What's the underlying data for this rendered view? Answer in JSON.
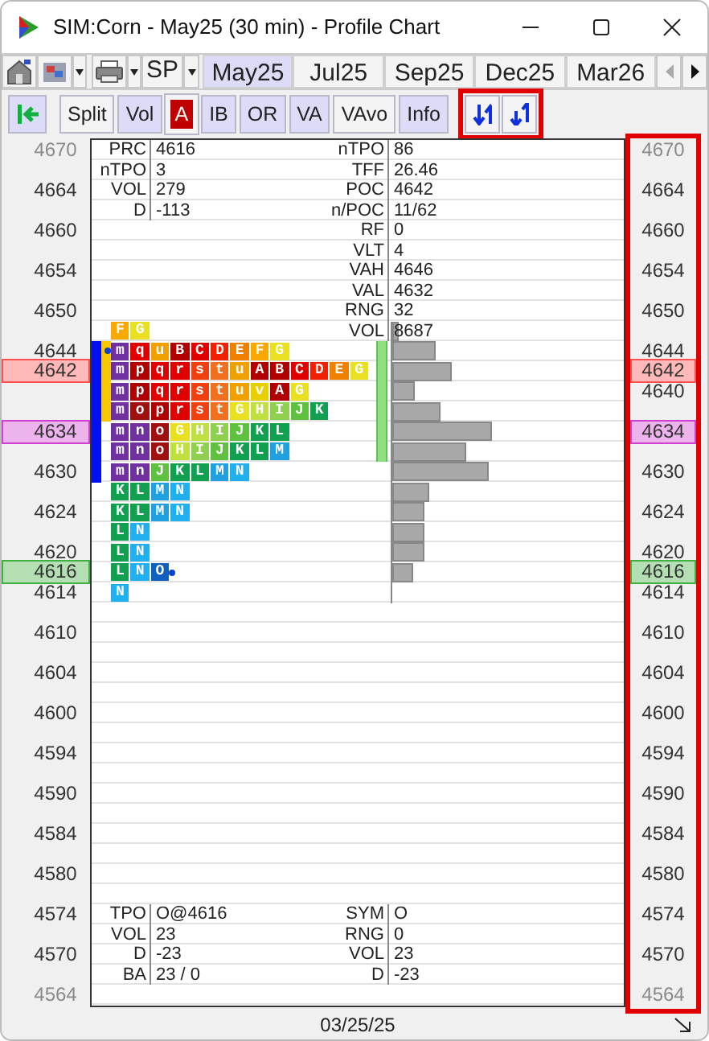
{
  "window": {
    "title": "SIM:Corn - May25 (30 min) - Profile Chart"
  },
  "tab_bar": {
    "symbol_menu": "SP",
    "tabs": [
      {
        "label": "May25",
        "selected": true
      },
      {
        "label": "Jul25",
        "selected": false
      },
      {
        "label": "Sep25",
        "selected": false
      },
      {
        "label": "Dec25",
        "selected": false
      },
      {
        "label": "Mar26",
        "selected": false
      }
    ],
    "scroll": [
      {
        "disabled": true
      },
      {
        "disabled": false
      }
    ]
  },
  "toolbar": [
    {
      "label": "Split",
      "kind": "toggle",
      "on": false
    },
    {
      "label": "Vol",
      "kind": "toggle",
      "on": true
    },
    {
      "label": "A",
      "kind": "color",
      "color": "#c00000"
    },
    {
      "label": "IB",
      "kind": "toggle",
      "on": true
    },
    {
      "label": "OR",
      "kind": "toggle",
      "on": true
    },
    {
      "label": "VA",
      "kind": "toggle",
      "on": true
    },
    {
      "label": "VAvo",
      "kind": "toggle",
      "on": false
    },
    {
      "label": "Info",
      "kind": "toggle",
      "on": true
    }
  ],
  "rows": [
    {
      "left_axis": {
        "text": "4670",
        "kind": "faded"
      },
      "right_axis": {
        "text": "4670",
        "kind": "faded"
      },
      "left_stat": {
        "label": "PRC",
        "value": "4616"
      },
      "right_stat": {
        "label": "nTPO",
        "value": "86"
      }
    },
    {
      "left_stat": {
        "label": "nTPO",
        "value": "3"
      },
      "right_stat": {
        "label": "TFF",
        "value": "26.46"
      }
    },
    {
      "left_axis": {
        "text": "4664",
        "kind": "plain"
      },
      "right_axis": {
        "text": "4664",
        "kind": "plain"
      },
      "left_stat": {
        "label": "VOL",
        "value": "279"
      },
      "right_stat": {
        "label": "POC",
        "value": "4642"
      }
    },
    {
      "left_stat": {
        "label": "D",
        "value": "-113"
      },
      "right_stat": {
        "label": "n/POC",
        "value": "11/62"
      }
    },
    {
      "left_axis": {
        "text": "4660",
        "kind": "plain"
      },
      "right_axis": {
        "text": "4660",
        "kind": "plain"
      },
      "right_stat": {
        "label": "RF",
        "value": "0"
      }
    },
    {
      "right_stat": {
        "label": "VLT",
        "value": "4"
      }
    },
    {
      "left_axis": {
        "text": "4654",
        "kind": "plain"
      },
      "right_axis": {
        "text": "4654",
        "kind": "plain"
      },
      "right_stat": {
        "label": "VAH",
        "value": "4646"
      }
    },
    {
      "right_stat": {
        "label": "VAL",
        "value": "4632"
      }
    },
    {
      "left_axis": {
        "text": "4650",
        "kind": "plain"
      },
      "right_axis": {
        "text": "4650",
        "kind": "plain"
      },
      "right_stat": {
        "label": "RNG",
        "value": "32"
      }
    },
    {
      "right_stat": {
        "label": "VOL",
        "value": "8687"
      },
      "tpos": [
        {
          "letter": "F",
          "color": "#f8a800"
        },
        {
          "letter": "G",
          "color": "#e8e020"
        }
      ],
      "volume": {
        "level": 0.03
      }
    },
    {
      "left_axis": {
        "text": "4644",
        "kind": "plain"
      },
      "right_axis": {
        "text": "4644",
        "kind": "plain"
      },
      "ib": true,
      "or": true,
      "va": true,
      "volume": {
        "level": 0.19
      },
      "tpos": [
        {
          "letter": "m",
          "color": "#7030a0",
          "dot": true
        },
        {
          "letter": "q",
          "color": "#e00000"
        },
        {
          "letter": "u",
          "color": "#f0a000"
        },
        {
          "letter": "B",
          "color": "#b00000"
        },
        {
          "letter": "C",
          "color": "#e00000"
        },
        {
          "letter": "D",
          "color": "#f02000"
        },
        {
          "letter": "E",
          "color": "#f08000"
        },
        {
          "letter": "F",
          "color": "#f8a800"
        },
        {
          "letter": "G",
          "color": "#e8e020"
        }
      ]
    },
    {
      "left_axis": {
        "text": "4642",
        "kind": "marker",
        "color": "#ff5050"
      },
      "right_axis": {
        "text": "4642",
        "kind": "marker",
        "color": "#ff5050"
      },
      "ib": true,
      "or": true,
      "va": true,
      "volume": {
        "level": 0.26
      },
      "tpos": [
        {
          "letter": "m",
          "color": "#7030a0"
        },
        {
          "letter": "p",
          "color": "#b00000"
        },
        {
          "letter": "q",
          "color": "#e00000"
        },
        {
          "letter": "r",
          "color": "#e00000"
        },
        {
          "letter": "s",
          "color": "#f04010"
        },
        {
          "letter": "t",
          "color": "#f07020"
        },
        {
          "letter": "u",
          "color": "#f0a000"
        },
        {
          "letter": "A",
          "color": "#b00000"
        },
        {
          "letter": "B",
          "color": "#b00000"
        },
        {
          "letter": "C",
          "color": "#e00000"
        },
        {
          "letter": "D",
          "color": "#f02000"
        },
        {
          "letter": "E",
          "color": "#f08000"
        },
        {
          "letter": "G",
          "color": "#e8e020"
        }
      ]
    },
    {
      "right_axis": {
        "text": "4640",
        "kind": "plain"
      },
      "ib": true,
      "or": true,
      "va": true,
      "volume": {
        "level": 0.1
      },
      "tpos": [
        {
          "letter": "m",
          "color": "#7030a0"
        },
        {
          "letter": "p",
          "color": "#b00000"
        },
        {
          "letter": "q",
          "color": "#e00000"
        },
        {
          "letter": "r",
          "color": "#e00000"
        },
        {
          "letter": "s",
          "color": "#f04010"
        },
        {
          "letter": "t",
          "color": "#f07020"
        },
        {
          "letter": "u",
          "color": "#f0a000"
        },
        {
          "letter": "v",
          "color": "#e8d000"
        },
        {
          "letter": "A",
          "color": "#b00000"
        },
        {
          "letter": "G",
          "color": "#e8e020"
        }
      ]
    },
    {
      "ib": true,
      "or": true,
      "va": true,
      "volume": {
        "level": 0.21
      },
      "tpos": [
        {
          "letter": "m",
          "color": "#7030a0"
        },
        {
          "letter": "o",
          "color": "#a01010"
        },
        {
          "letter": "p",
          "color": "#b00000"
        },
        {
          "letter": "r",
          "color": "#e00000"
        },
        {
          "letter": "s",
          "color": "#f04010"
        },
        {
          "letter": "t",
          "color": "#f07020"
        },
        {
          "letter": "G",
          "color": "#e8e020"
        },
        {
          "letter": "H",
          "color": "#c0e040"
        },
        {
          "letter": "I",
          "color": "#90d050"
        },
        {
          "letter": "J",
          "color": "#60c040"
        },
        {
          "letter": "K",
          "color": "#10a050"
        }
      ]
    },
    {
      "left_axis": {
        "text": "4634",
        "kind": "marker",
        "color": "#d040d0"
      },
      "right_axis": {
        "text": "4634",
        "kind": "marker",
        "color": "#d040d0"
      },
      "ib": true,
      "va": true,
      "volume": {
        "level": 0.43
      },
      "tpos": [
        {
          "letter": "m",
          "color": "#7030a0"
        },
        {
          "letter": "n",
          "color": "#7030a0"
        },
        {
          "letter": "o",
          "color": "#a01010"
        },
        {
          "letter": "G",
          "color": "#e8e020"
        },
        {
          "letter": "H",
          "color": "#c0e040"
        },
        {
          "letter": "I",
          "color": "#90d050"
        },
        {
          "letter": "J",
          "color": "#60c040"
        },
        {
          "letter": "K",
          "color": "#10a050"
        },
        {
          "letter": "L",
          "color": "#10a050"
        }
      ]
    },
    {
      "ib": true,
      "va": true,
      "volume": {
        "level": 0.32
      },
      "tpos": [
        {
          "letter": "m",
          "color": "#7030a0"
        },
        {
          "letter": "n",
          "color": "#7030a0"
        },
        {
          "letter": "o",
          "color": "#a01010"
        },
        {
          "letter": "H",
          "color": "#c0e040"
        },
        {
          "letter": "I",
          "color": "#90d050"
        },
        {
          "letter": "J",
          "color": "#60c040"
        },
        {
          "letter": "K",
          "color": "#10a050"
        },
        {
          "letter": "L",
          "color": "#10a050"
        },
        {
          "letter": "M",
          "color": "#20a0e0"
        }
      ]
    },
    {
      "left_axis": {
        "text": "4630",
        "kind": "plain"
      },
      "right_axis": {
        "text": "4630",
        "kind": "plain"
      },
      "ib": true,
      "volume": {
        "level": 0.42
      },
      "tpos": [
        {
          "letter": "m",
          "color": "#7030a0"
        },
        {
          "letter": "n",
          "color": "#7030a0"
        },
        {
          "letter": "J",
          "color": "#60c040"
        },
        {
          "letter": "K",
          "color": "#10a050"
        },
        {
          "letter": "L",
          "color": "#10a050"
        },
        {
          "letter": "M",
          "color": "#20a0e0"
        },
        {
          "letter": "N",
          "color": "#20b0f0"
        }
      ]
    },
    {
      "volume": {
        "level": 0.16
      },
      "tpos": [
        {
          "letter": "K",
          "color": "#10a050"
        },
        {
          "letter": "L",
          "color": "#10a050"
        },
        {
          "letter": "M",
          "color": "#20a0e0"
        },
        {
          "letter": "N",
          "color": "#20b0f0"
        }
      ]
    },
    {
      "left_axis": {
        "text": "4624",
        "kind": "plain"
      },
      "right_axis": {
        "text": "4624",
        "kind": "plain"
      },
      "volume": {
        "level": 0.14
      },
      "tpos": [
        {
          "letter": "K",
          "color": "#10a050"
        },
        {
          "letter": "L",
          "color": "#10a050"
        },
        {
          "letter": "M",
          "color": "#20a0e0"
        },
        {
          "letter": "N",
          "color": "#20b0f0"
        }
      ]
    },
    {
      "volume": {
        "level": 0.14
      },
      "tpos": [
        {
          "letter": "L",
          "color": "#10a050"
        },
        {
          "letter": "N",
          "color": "#20b0f0"
        }
      ]
    },
    {
      "left_axis": {
        "text": "4620",
        "kind": "plain"
      },
      "right_axis": {
        "text": "4620",
        "kind": "plain"
      },
      "volume": {
        "level": 0.14
      },
      "tpos": [
        {
          "letter": "L",
          "color": "#10a050"
        },
        {
          "letter": "N",
          "color": "#20b0f0"
        }
      ]
    },
    {
      "left_axis": {
        "text": "4616",
        "kind": "marker",
        "color": "#40b040"
      },
      "right_axis": {
        "text": "4616",
        "kind": "marker",
        "color": "#40b040"
      },
      "volume": {
        "level": 0.09
      },
      "tpos": [
        {
          "letter": "L",
          "color": "#10a050"
        },
        {
          "letter": "N",
          "color": "#20b0f0"
        },
        {
          "letter": "O",
          "color": "#1060c0",
          "dot": true
        }
      ]
    },
    {
      "left_axis": {
        "text": "4614",
        "kind": "plain"
      },
      "right_axis": {
        "text": "4614",
        "kind": "plain"
      },
      "volume": {
        "level": 0
      },
      "tpos": [
        {
          "letter": "N",
          "color": "#20b0f0"
        }
      ]
    },
    {},
    {
      "left_axis": {
        "text": "4610",
        "kind": "plain"
      },
      "right_axis": {
        "text": "4610",
        "kind": "plain"
      }
    },
    {},
    {
      "left_axis": {
        "text": "4604",
        "kind": "plain"
      },
      "right_axis": {
        "text": "4604",
        "kind": "plain"
      }
    },
    {},
    {
      "left_axis": {
        "text": "4600",
        "kind": "plain"
      },
      "right_axis": {
        "text": "4600",
        "kind": "plain"
      }
    },
    {},
    {
      "left_axis": {
        "text": "4594",
        "kind": "plain"
      },
      "right_axis": {
        "text": "4594",
        "kind": "plain"
      }
    },
    {},
    {
      "left_axis": {
        "text": "4590",
        "kind": "plain"
      },
      "right_axis": {
        "text": "4590",
        "kind": "plain"
      }
    },
    {},
    {
      "left_axis": {
        "text": "4584",
        "kind": "plain"
      },
      "right_axis": {
        "text": "4584",
        "kind": "plain"
      }
    },
    {},
    {
      "left_axis": {
        "text": "4580",
        "kind": "plain"
      },
      "right_axis": {
        "text": "4580",
        "kind": "plain"
      }
    },
    {},
    {
      "left_axis": {
        "text": "4574",
        "kind": "plain"
      },
      "right_axis": {
        "text": "4574",
        "kind": "plain"
      },
      "left_stat": {
        "label": "TPO",
        "value": "O@4616"
      },
      "right_stat": {
        "label": "SYM",
        "value": "O"
      }
    },
    {
      "left_stat": {
        "label": "VOL",
        "value": "23"
      },
      "right_stat": {
        "label": "RNG",
        "value": "0"
      }
    },
    {
      "left_axis": {
        "text": "4570",
        "kind": "plain"
      },
      "right_axis": {
        "text": "4570",
        "kind": "plain"
      },
      "left_stat": {
        "label": "D",
        "value": "-23"
      },
      "right_stat": {
        "label": "VOL",
        "value": "23"
      }
    },
    {
      "left_stat": {
        "label": "BA",
        "value": "23 / 0"
      },
      "right_stat": {
        "label": "D",
        "value": "-23"
      }
    },
    {
      "left_axis": {
        "text": "4564",
        "kind": "faded"
      },
      "right_axis": {
        "text": "4564",
        "kind": "faded"
      }
    }
  ],
  "date": "03/25/25"
}
